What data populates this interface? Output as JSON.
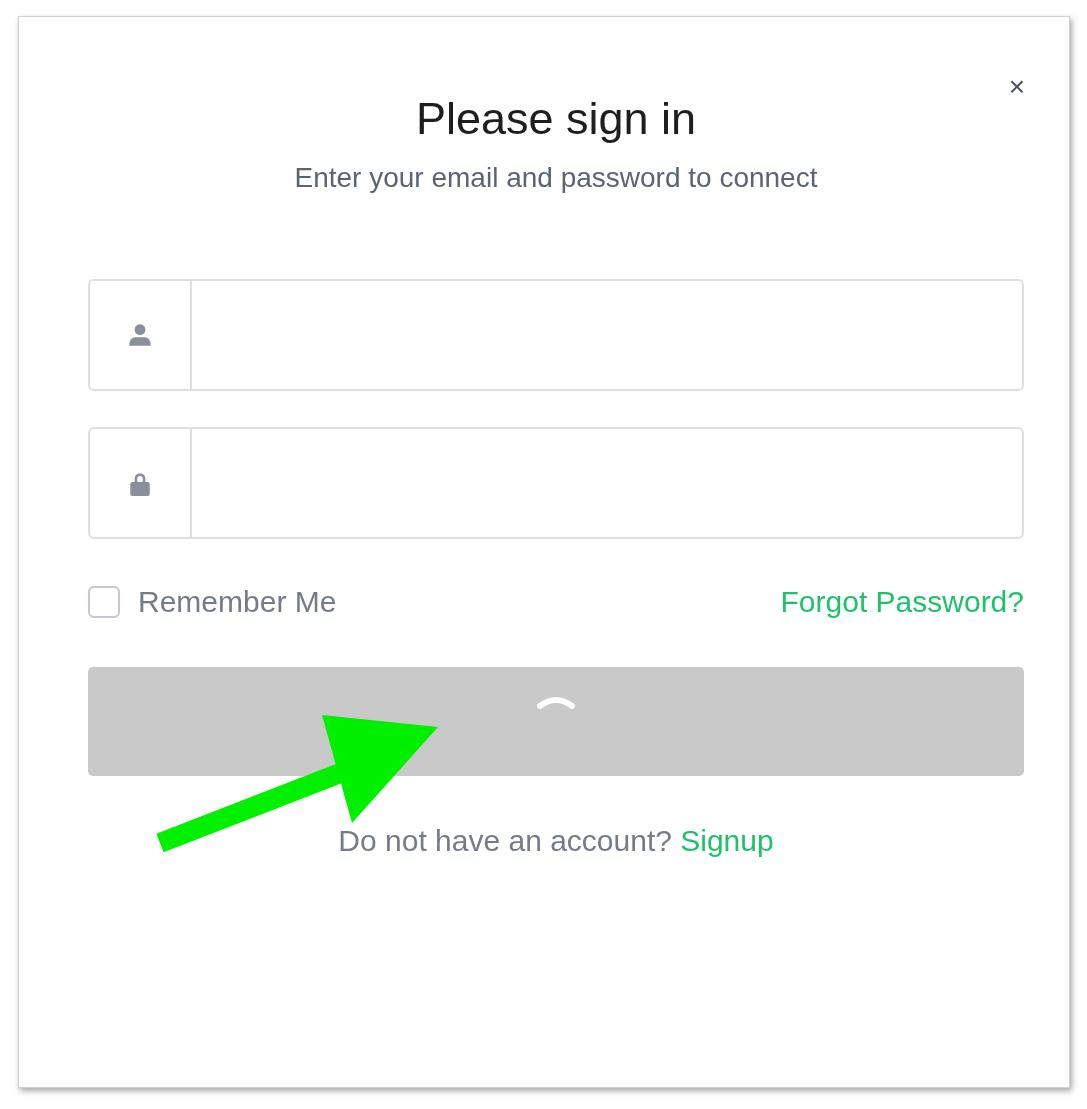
{
  "dialog": {
    "close": "×",
    "title": "Please sign in",
    "subtitle": "Enter your email and password to connect",
    "fields": [
      {
        "kind": "user"
      },
      {
        "kind": "password"
      }
    ],
    "remember": {
      "label": "Remember Me",
      "checked": false
    },
    "forgot_link": "Forgot Password?",
    "submit": {
      "loading": true
    },
    "signup": {
      "prompt": "Do not have an account?",
      "link": "Signup"
    }
  }
}
